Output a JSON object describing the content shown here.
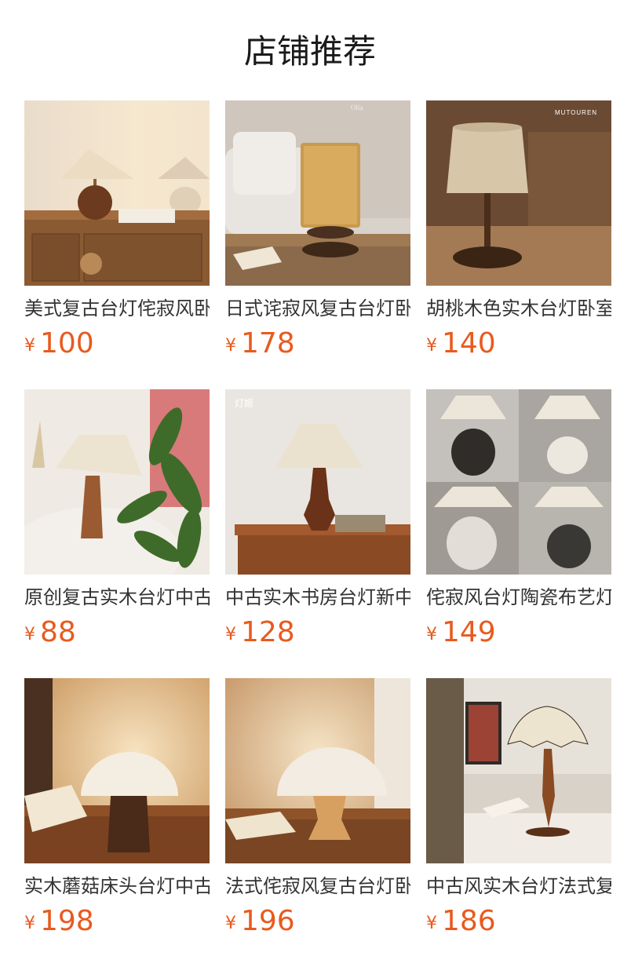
{
  "header": {
    "title": "店铺推荐"
  },
  "currency_symbol": "¥",
  "colors": {
    "price": "#e85a1e",
    "title": "#1a1a1a",
    "name": "#333333"
  },
  "products": [
    {
      "name": "美式复古台灯侘寂风卧室床头灯",
      "price": "100",
      "image": "walnut-base-lamp-photo"
    },
    {
      "name": "日式诧寂风复古台灯卧室客厅",
      "price": "178",
      "image": "rattan-cylinder-lamp-photo",
      "logo": "Olia"
    },
    {
      "name": "胡桃木色实木台灯卧室床头灯",
      "price": "140",
      "image": "linen-shade-lamp-photo",
      "brand_watermark": "MUTOUREN"
    },
    {
      "name": "原创复古实木台灯中古风卧室",
      "price": "88",
      "image": "cone-base-lamp-photo"
    },
    {
      "name": "中古实木书房台灯新中式客厅",
      "price": "128",
      "image": "turned-wood-lamp-photo",
      "brand_watermark": "灯姬"
    },
    {
      "name": "侘寂风台灯陶瓷布艺灯罩卧室",
      "price": "149",
      "image": "ceramic-lamp-collage-photo"
    },
    {
      "name": "实木蘑菇床头台灯中古风卧室",
      "price": "198",
      "image": "mushroom-dark-wood-lamp-photo"
    },
    {
      "name": "法式侘寂风复古台灯卧室床头",
      "price": "196",
      "image": "mushroom-light-wood-lamp-photo"
    },
    {
      "name": "中古风实木台灯法式复古卧室",
      "price": "186",
      "image": "scalloped-shade-lamp-photo"
    }
  ]
}
